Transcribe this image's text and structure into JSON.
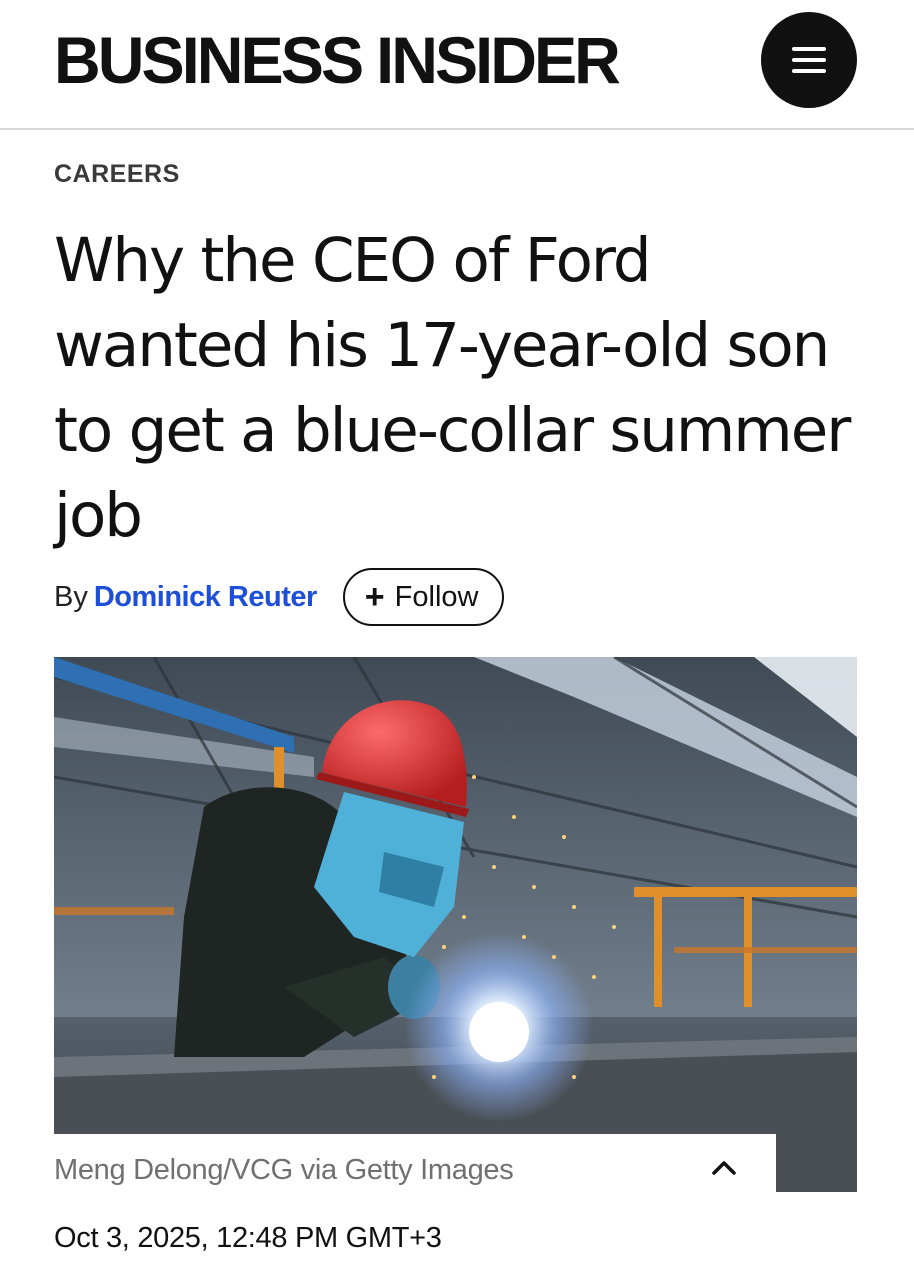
{
  "header": {
    "logo": "BUSINESS INSIDER",
    "menu_icon": "hamburger-menu-icon"
  },
  "article": {
    "category": "CAREERS",
    "headline": "Why the CEO of Ford wanted his 17-year-old son to get a blue-collar summer job",
    "byline_prefix": "By",
    "author": "Dominick Reuter",
    "follow_label": "Follow",
    "follow_icon": "plus-icon",
    "image_caption": "Meng Delong/VCG via Getty Images",
    "caption_toggle_icon": "chevron-up-icon",
    "date": "Oct 3, 2025, 12:48 PM GMT+3"
  },
  "colors": {
    "author_link": "#1d4fd8",
    "text": "#111111",
    "caption": "#707070"
  }
}
